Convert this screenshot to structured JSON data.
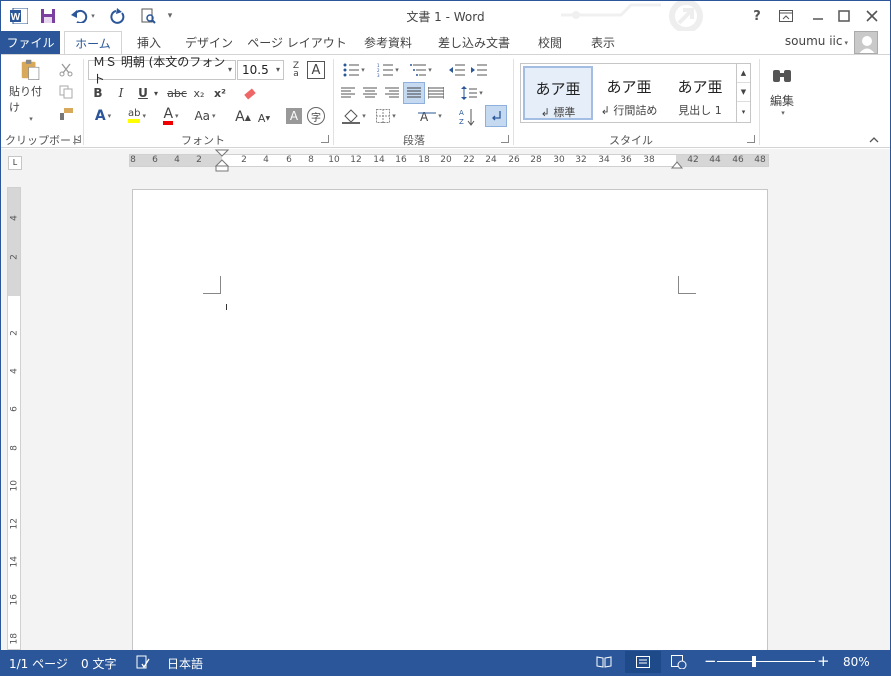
{
  "app": {
    "title": "文書 1 - Word",
    "user": "soumu iic",
    "window_controls": {
      "help": "?",
      "ribbon_display": "ribbon-display-icon",
      "minimize": "minimize-icon",
      "maximize": "maximize-icon",
      "close": "close-icon"
    }
  },
  "tabs": [
    {
      "label": "ファイル"
    },
    {
      "label": "ホーム"
    },
    {
      "label": "挿入"
    },
    {
      "label": "デザイン"
    },
    {
      "label": "ページ レイアウト"
    },
    {
      "label": "参考資料"
    },
    {
      "label": "差し込み文書"
    },
    {
      "label": "校閲"
    },
    {
      "label": "表示"
    }
  ],
  "ribbon": {
    "clipboard": {
      "label": "クリップボード",
      "paste_label": "貼り付け"
    },
    "font": {
      "label": "フォント",
      "font_name": "ＭＳ 明朝 (本文のフォント",
      "font_size": "10.5",
      "bold": "B",
      "italic": "I",
      "underline": "U",
      "strikethrough": "abc",
      "subscript": "x₂",
      "superscript": "x²",
      "grow": "A",
      "shrink": "A",
      "change_case": "Aa",
      "phonetic": "字"
    },
    "paragraph": {
      "label": "段落"
    },
    "styles": {
      "label": "スタイル",
      "items": [
        {
          "sample": "あア亜",
          "name": "↲ 標準"
        },
        {
          "sample": "あア亜",
          "name": "↲ 行間詰め"
        },
        {
          "sample": "あア亜",
          "name": "見出し 1"
        }
      ]
    },
    "editing": {
      "label": "編集"
    }
  },
  "ruler": {
    "ticks": [
      "8",
      "6",
      "4",
      "2",
      "2",
      "4",
      "6",
      "8",
      "10",
      "12",
      "14",
      "16",
      "18",
      "20",
      "22",
      "24",
      "26",
      "28",
      "30",
      "32",
      "34",
      "36",
      "38",
      "42",
      "44",
      "46",
      "48"
    ],
    "vticks": [
      "4",
      "2",
      "2",
      "4",
      "6",
      "8",
      "10",
      "12",
      "14",
      "16",
      "18"
    ],
    "corner": "L"
  },
  "status": {
    "page": "1/1 ページ",
    "words": "0 文字",
    "language": "日本語",
    "zoom": "80%",
    "zoom_minus": "−",
    "zoom_plus": "+"
  }
}
